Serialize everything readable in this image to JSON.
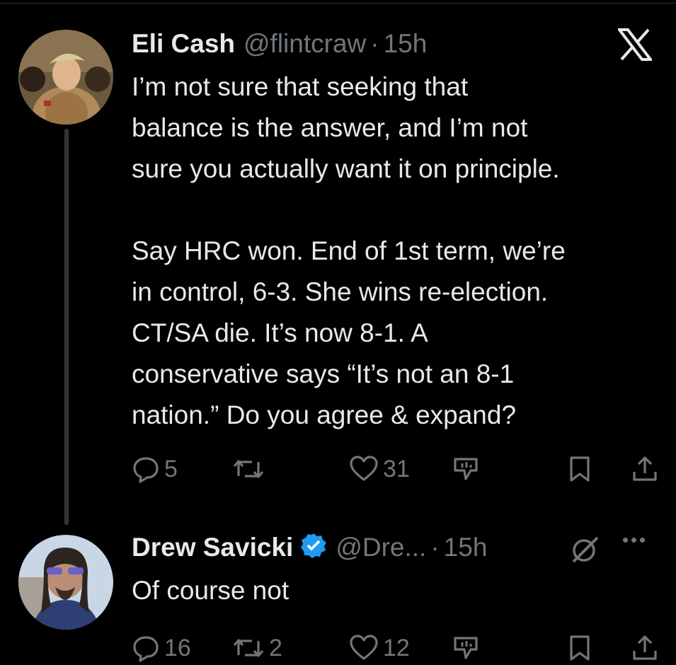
{
  "tweet1": {
    "name": "Eli Cash",
    "handle": "@flintcraw",
    "separator": "·",
    "time": "15h",
    "para1_line1": "I’m not sure that seeking that",
    "para1_line2": "balance is the answer, and I’m not",
    "para1_line3": "sure you actually want it on principle.",
    "para2_line1": "Say HRC won. End of 1st term, we’re",
    "para2_line2": "in control, 6-3. She wins re-election.",
    "para2_line3": "CT/SA die. It’s now 8-1. A",
    "para2_line4": "conservative says “It’s not an 8-1",
    "para2_line5": "nation.” Do you agree & expand?",
    "replies": "5",
    "retweets": "",
    "likes": "31"
  },
  "tweet2": {
    "name": "Drew Savicki",
    "handle": "@Dre...",
    "separator": "·",
    "time": "15h",
    "text": "Of course not",
    "replies": "16",
    "retweets": "2",
    "likes": "12"
  },
  "icons": {
    "brand": "x-logo-icon",
    "verified": "verified-badge-icon",
    "reply": "reply-icon",
    "retweet": "retweet-icon",
    "like": "heart-icon",
    "analytics": "analytics-icon",
    "bookmark": "bookmark-icon",
    "share": "share-icon",
    "grok": "grok-icon",
    "more": "more-icon"
  },
  "colors": {
    "background": "#000000",
    "text": "#e7e9ea",
    "secondary": "#71767b",
    "verified": "#1d9bf0"
  }
}
